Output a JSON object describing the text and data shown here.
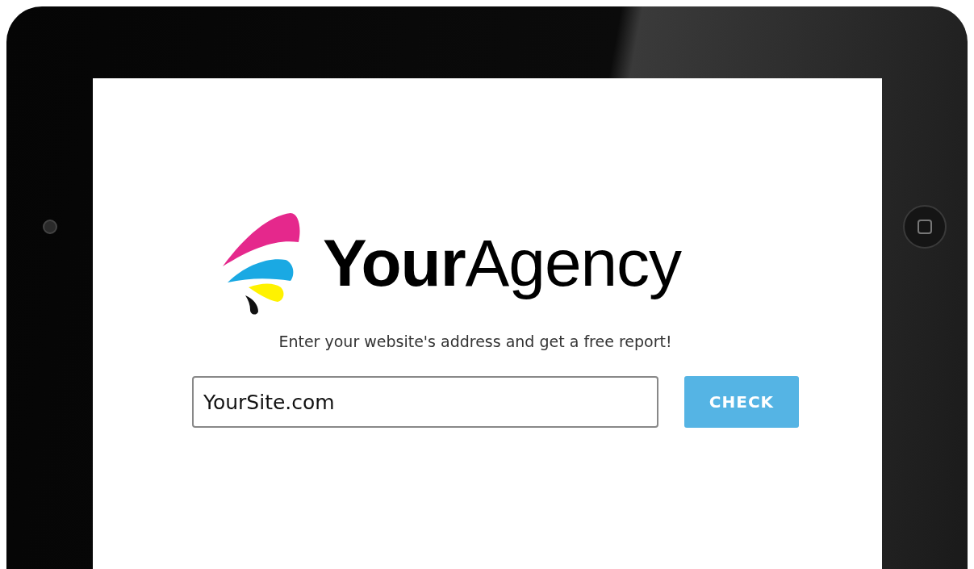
{
  "logo": {
    "text": "**Your**Agency"
  },
  "tagline": "Enter your website's address and get a free report!",
  "url_field": {
    "value": "YourSite.com"
  },
  "check_button": {
    "label": "CHECK"
  }
}
